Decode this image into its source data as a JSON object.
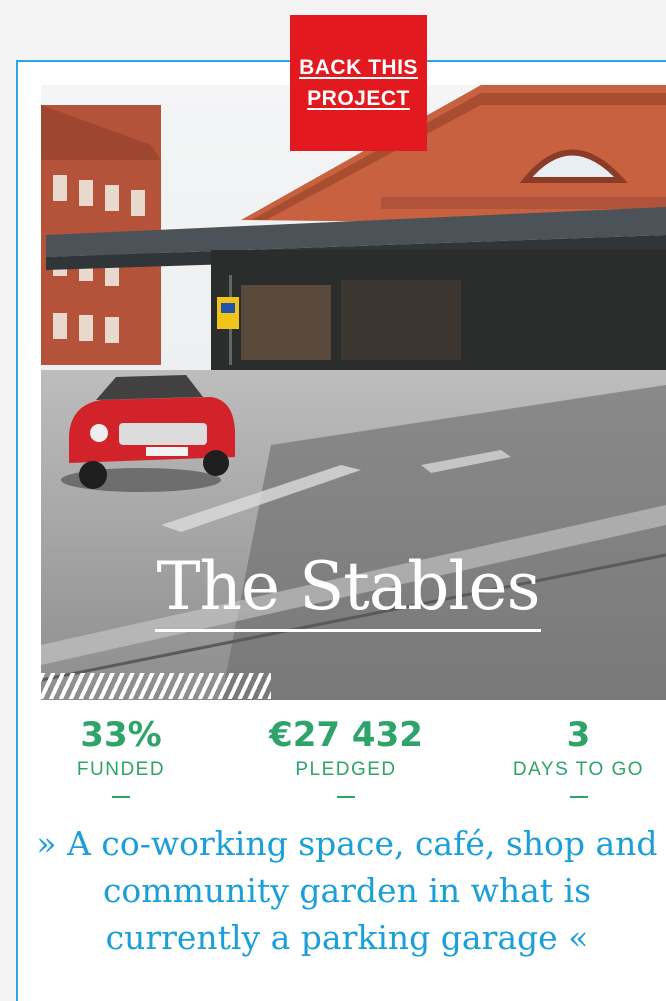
{
  "cta": {
    "back_label": "BACK THIS PROJECT"
  },
  "project": {
    "title": "The Stables",
    "tagline": "» A co-working space, café, shop and community garden in what is currently a parking garage «"
  },
  "stats": {
    "funded": {
      "value": "33%",
      "label": "FUNDED"
    },
    "pledged": {
      "value": "€27 432",
      "label": "PLEDGED"
    },
    "days": {
      "value": "3",
      "label": "DAYS TO GO"
    }
  },
  "colors": {
    "cta_red": "#e2191f",
    "border_blue": "#2aa7e0",
    "stat_green": "#2ea36a",
    "tagline_blue": "#1a9fd9"
  },
  "icons": {
    "hero": "street-photo-with-red-car"
  }
}
